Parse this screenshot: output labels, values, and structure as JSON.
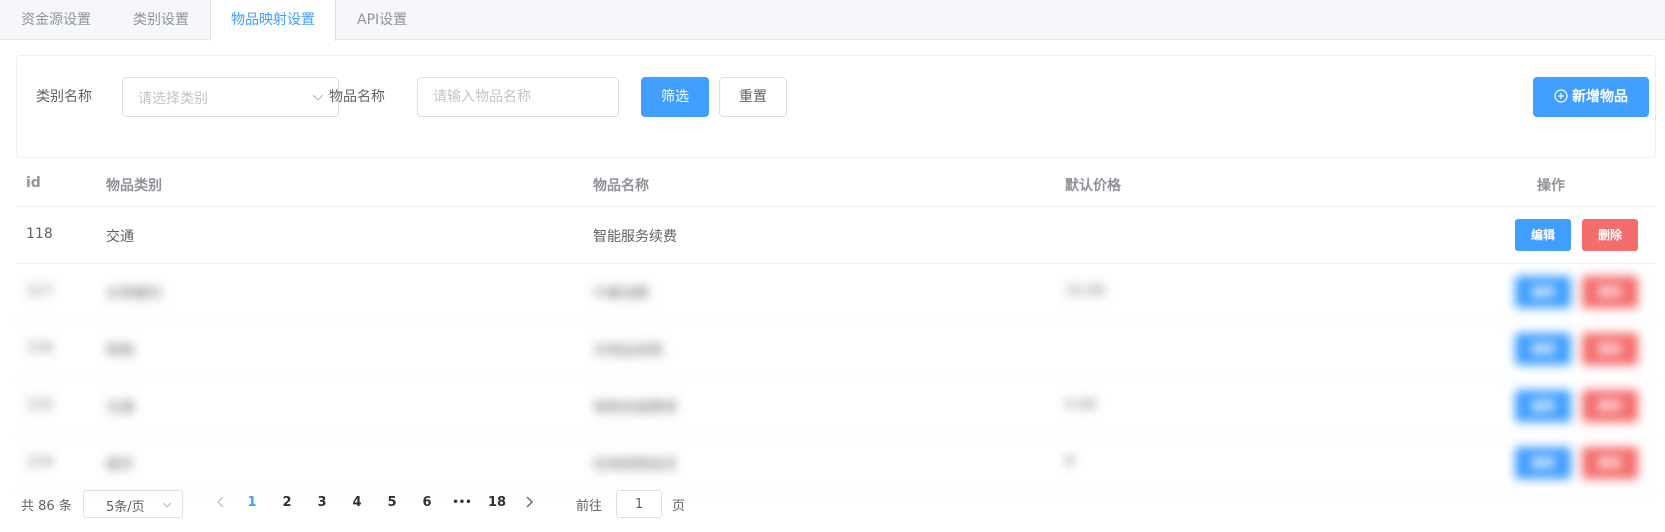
{
  "tabs": [
    {
      "label": "资金源设置"
    },
    {
      "label": "类别设置"
    },
    {
      "label": "物品映射设置"
    },
    {
      "label": "API设置"
    }
  ],
  "filter": {
    "category_label": "类别名称",
    "category_placeholder": "请选择类别",
    "name_label": "物品名称",
    "name_placeholder": "请输入物品名称",
    "filter_button": "筛选",
    "reset_button": "重置",
    "add_button": "新增物品"
  },
  "table": {
    "headers": [
      "id",
      "物品类别",
      "物品名称",
      "默认价格",
      "操作"
    ],
    "rows": [
      {
        "id": "118",
        "category": "交通",
        "name": "智能服务续费",
        "price": ""
      },
      {
        "id": "117",
        "category": "日常餐饮",
        "name": "午餐消费",
        "price": "15.00"
      },
      {
        "id": "116",
        "category": "购物",
        "name": "日用品采购",
        "price": ""
      },
      {
        "id": "115",
        "category": "交通",
        "name": "地铁充值费用",
        "price": "5.00"
      },
      {
        "id": "114",
        "category": "娱乐",
        "name": "在线视频会员",
        "price": "9"
      }
    ],
    "edit_label": "编辑",
    "delete_label": "删除"
  },
  "pagination": {
    "total_text": "共 86 条",
    "page_size": "5条/页",
    "pages": [
      "1",
      "2",
      "3",
      "4",
      "5",
      "6"
    ],
    "ellipsis": "•••",
    "last_page": "18",
    "current_page": "1",
    "goto_label": "前往",
    "goto_value": "1",
    "page_suffix": "页"
  },
  "colors": {
    "primary": "#409eff",
    "danger": "#f56c6c"
  }
}
